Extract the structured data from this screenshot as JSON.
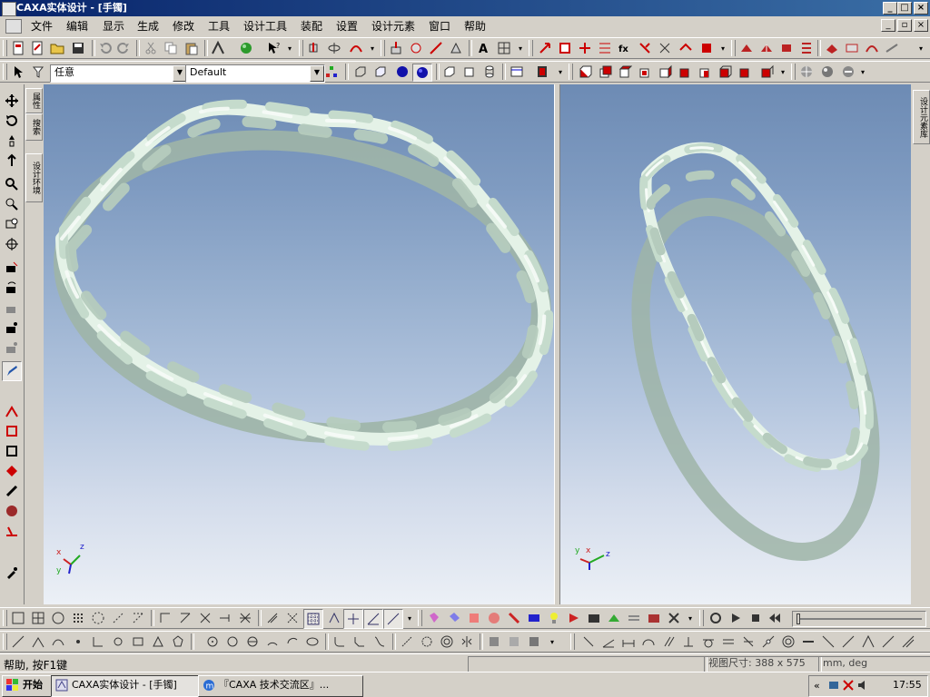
{
  "window": {
    "title": "CAXA实体设计 - [手镯]"
  },
  "menus": [
    "文件",
    "编辑",
    "显示",
    "生成",
    "修改",
    "工具",
    "设计工具",
    "装配",
    "设置",
    "设计元素",
    "窗口",
    "帮助"
  ],
  "filter_combo": {
    "value": "任意"
  },
  "style_combo": {
    "value": "Default"
  },
  "side_tabs": {
    "properties": "属性",
    "search": "搜索",
    "design_env": "设计环境"
  },
  "right_panel_tab": "设计元素库",
  "status": {
    "help_text": "帮助, 按F1键",
    "view_size": "视图尺寸: 388 x 575",
    "units": "mm, deg"
  },
  "taskbar": {
    "start": "开始",
    "tasks": [
      {
        "label": "CAXA实体设计 - [手镯]"
      },
      {
        "label": "『CAXA 技术交流区』..."
      }
    ],
    "clock": "17:55"
  },
  "axes_labels": {
    "x": "x",
    "y": "y",
    "z": "z"
  },
  "colors": {
    "title_start": "#08246b",
    "title_end": "#3a6ea5",
    "bracelet": "#dcebe1",
    "viewport_top": "#6d8bb4",
    "viewport_bottom": "#ecf0f6"
  }
}
